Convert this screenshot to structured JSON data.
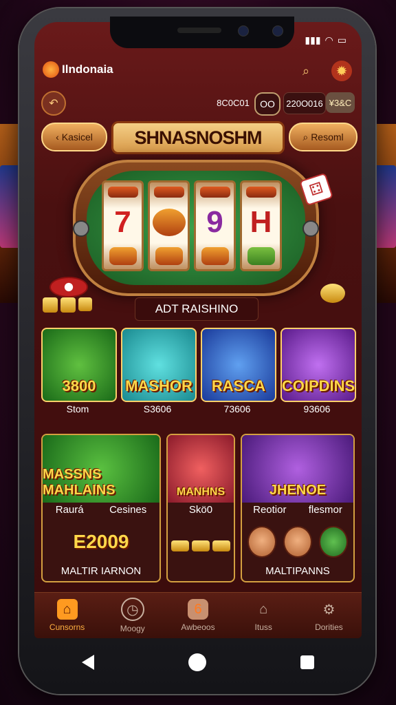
{
  "app": {
    "name": "Ilndonaia",
    "status_icons": [
      "signal-icon",
      "wifi-icon",
      "battery-icon"
    ]
  },
  "header": {
    "search_icon": "search-icon",
    "settings_icon": "gear-icon"
  },
  "topbar": {
    "back_icon": "back-icon",
    "stat1": "8C0C01",
    "stat2": "OO",
    "stat3": "220O016",
    "stat4": "¥3&C"
  },
  "nav": {
    "back_label": "Kasicel",
    "forward_label": "Resoml"
  },
  "banner": {
    "title": "SHNASNOSHM"
  },
  "slot": {
    "reels": [
      "7",
      "",
      "9",
      "H"
    ],
    "subtitle": "ADT RAISHINO"
  },
  "games_row1": [
    {
      "art_text": "3800",
      "label": "Stom",
      "color": "#2e8a2a"
    },
    {
      "art_text": "MASHOR",
      "label": "S3606",
      "color": "#2aa0a8"
    },
    {
      "art_text": "RASCA",
      "label": "73606",
      "color": "#2a6ac0"
    },
    {
      "art_text": "COIPDINS",
      "label": "93606",
      "color": "#8a2ab0"
    }
  ],
  "games_row2": [
    {
      "art_text": "MASSNS MAHLAINS",
      "mid_left": "Raurá",
      "mid_right": "Cesines",
      "lower_text": "E2009",
      "label": "MALTIR IARNON",
      "color": "#2a8a30"
    },
    {
      "art_text": "MANHNS",
      "mid_left": "Skö0",
      "mid_right": "",
      "lower_text": "",
      "label": "",
      "color": "#c02a3a"
    },
    {
      "art_text": "JHENOE",
      "mid_left": "Reotior",
      "mid_right": "flesmor",
      "lower_text": "",
      "label": "MALTIPANNS",
      "color": "#7a2aa0"
    }
  ],
  "tabs": [
    {
      "label": "Cunsorns",
      "icon": "home-icon",
      "active": true
    },
    {
      "label": "Moogy",
      "icon": "clock-icon",
      "active": false
    },
    {
      "label": "Awbeoos",
      "icon": "badge-icon",
      "active": false
    },
    {
      "label": "Ituss",
      "icon": "house-icon",
      "active": false
    },
    {
      "label": "Dorities",
      "icon": "settings-icon",
      "active": false
    }
  ],
  "colors": {
    "accent": "#ffb040",
    "gold": "#ffd84a",
    "bg": "#3a0c0c"
  }
}
